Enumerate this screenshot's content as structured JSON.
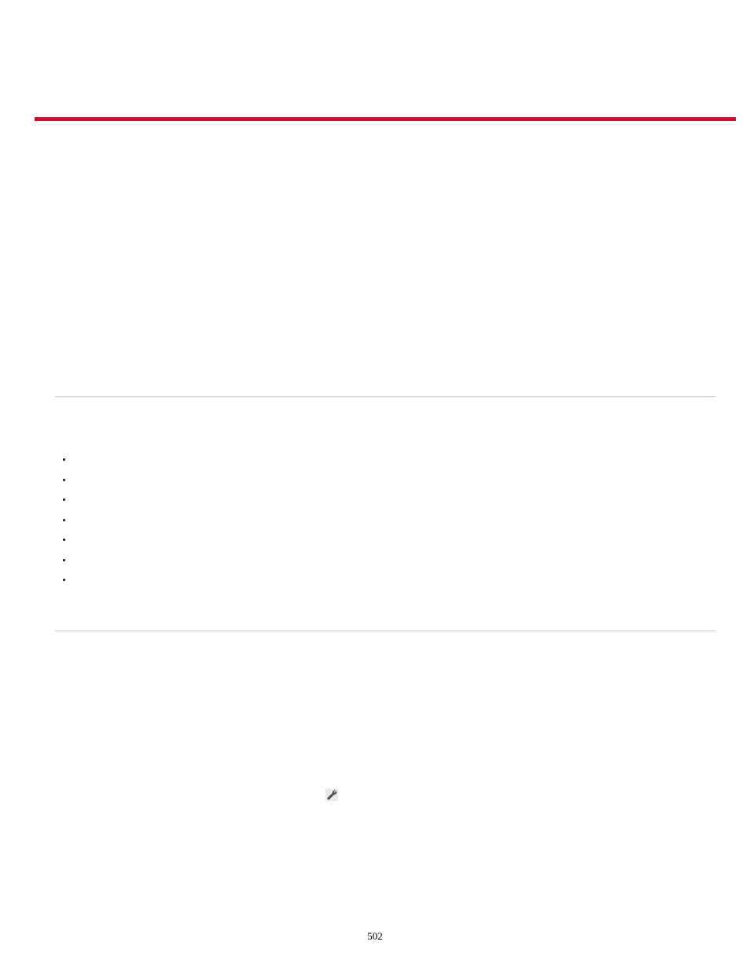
{
  "page_number": "502",
  "bullets": [
    "",
    "",
    "",
    "",
    "",
    "",
    ""
  ]
}
